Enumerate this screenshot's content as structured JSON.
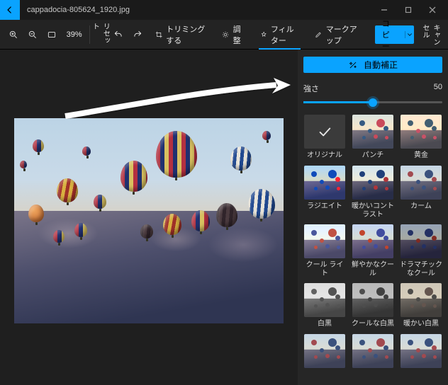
{
  "window": {
    "filename": "cappadocia-805624_1920.jpg"
  },
  "toolbar": {
    "zoom_pct": "39%",
    "reset": "リセット",
    "crop": "トリミングする",
    "adjust": "調整",
    "filter": "フィルター",
    "markup": "マークアップ",
    "copy": "コピー",
    "cancel": "キャンセル"
  },
  "panel": {
    "auto_enhance": "自動補正",
    "strength_label": "強さ",
    "strength_value": "50",
    "slider_percent": 50
  },
  "filters": [
    {
      "key": "original",
      "label": "オリジナル",
      "variant": "sel"
    },
    {
      "key": "punch",
      "label": "パンチ",
      "variant": "warm"
    },
    {
      "key": "golden",
      "label": "黄金",
      "variant": "gold"
    },
    {
      "key": "radiate",
      "label": "ラジエイト",
      "variant": "rad"
    },
    {
      "key": "warm_contrast",
      "label": "暖かいコントラスト",
      "variant": "wcon",
      "two": true
    },
    {
      "key": "calm",
      "label": "カーム",
      "variant": "calm"
    },
    {
      "key": "cool_light",
      "label": "クール ライト",
      "variant": "cooll"
    },
    {
      "key": "vivid_cool",
      "label": "鮮やかなクール",
      "variant": "vcool",
      "two": true
    },
    {
      "key": "dramatic_cool",
      "label": "ドラマチックなクール",
      "variant": "dcool",
      "two": true
    },
    {
      "key": "bw",
      "label": "白黒",
      "variant": "bw"
    },
    {
      "key": "cool_bw",
      "label": "クールな白黒",
      "variant": "coolbw"
    },
    {
      "key": "warm_bw",
      "label": "暖かい白黒",
      "variant": "warmbw"
    },
    {
      "key": "extra1",
      "label": "",
      "variant": "calm"
    },
    {
      "key": "extra2",
      "label": "",
      "variant": "calm"
    },
    {
      "key": "extra3",
      "label": "",
      "variant": "calm"
    }
  ],
  "colors": {
    "accent": "#0aa3ff"
  }
}
